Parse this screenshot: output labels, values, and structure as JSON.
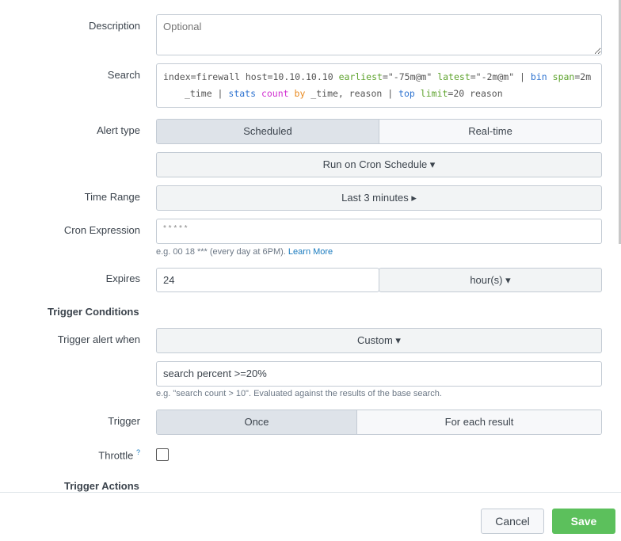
{
  "description": {
    "label": "Description",
    "placeholder": "Optional"
  },
  "search": {
    "label": "Search",
    "line1": [
      {
        "t": "index=firewall host=10.10.10.10 ",
        "c": ""
      },
      {
        "t": "earliest",
        "c": "k1"
      },
      {
        "t": "=\"-75m@m\" ",
        "c": ""
      },
      {
        "t": "latest",
        "c": "k1"
      },
      {
        "t": "=\"-2m@m\" | ",
        "c": ""
      },
      {
        "t": "bin",
        "c": "k2"
      },
      {
        "t": " ",
        "c": ""
      },
      {
        "t": "span",
        "c": "k1"
      },
      {
        "t": "=2m",
        "c": ""
      }
    ],
    "line2": [
      {
        "t": "_time | ",
        "c": ""
      },
      {
        "t": "stats",
        "c": "k2"
      },
      {
        "t": " ",
        "c": ""
      },
      {
        "t": "count",
        "c": "k3"
      },
      {
        "t": " ",
        "c": ""
      },
      {
        "t": "by",
        "c": "k4"
      },
      {
        "t": " _time, reason | ",
        "c": ""
      },
      {
        "t": "top",
        "c": "k2"
      },
      {
        "t": " ",
        "c": ""
      },
      {
        "t": "limit",
        "c": "k1"
      },
      {
        "t": "=20 reason",
        "c": ""
      }
    ]
  },
  "alert_type": {
    "label": "Alert type",
    "options": [
      "Scheduled",
      "Real-time"
    ],
    "selected": "Scheduled",
    "schedule": "Run on Cron Schedule ▾"
  },
  "time_range": {
    "label": "Time Range",
    "value": "Last 3 minutes ▸"
  },
  "cron": {
    "label": "Cron Expression",
    "value": "* * * * *",
    "help": "e.g. 00 18 *** (every day at 6PM). ",
    "learn_more": "Learn More"
  },
  "expires": {
    "label": "Expires",
    "value": "24",
    "unit": "hour(s) ▾"
  },
  "trigger_conditions": {
    "heading": "Trigger Conditions",
    "when_label": "Trigger alert when",
    "when_value": "Custom ▾",
    "condition": "search percent >=20%",
    "condition_help": "e.g. \"search count > 10\". Evaluated against the results of the base search."
  },
  "trigger": {
    "label": "Trigger",
    "options": [
      "Once",
      "For each result"
    ],
    "selected": "Once"
  },
  "throttle": {
    "label": "Throttle",
    "help_icon": "?",
    "checked": false
  },
  "trigger_actions": {
    "heading": "Trigger Actions"
  },
  "footer": {
    "cancel": "Cancel",
    "save": "Save"
  },
  "colors": {
    "save": "#5cc05c",
    "accent": "#1a7bbf"
  }
}
